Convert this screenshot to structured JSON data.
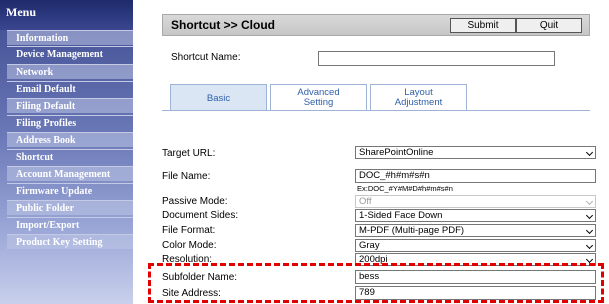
{
  "menu": {
    "title": "Menu",
    "items": [
      {
        "label": "Information"
      },
      {
        "label": "Device Management"
      },
      {
        "label": "Network"
      },
      {
        "label": "Email Default"
      },
      {
        "label": "Filing Default"
      },
      {
        "label": "Filing Profiles"
      },
      {
        "label": "Address Book"
      },
      {
        "label": "Shortcut"
      },
      {
        "label": "Account Management"
      },
      {
        "label": "Firmware Update"
      },
      {
        "label": "Public Folder"
      },
      {
        "label": "Import/Export"
      },
      {
        "label": "Product Key Setting"
      }
    ]
  },
  "header": {
    "title": "Shortcut >> Cloud",
    "submit_label": "Submit",
    "quit_label": "Quit"
  },
  "shortcut_name": {
    "label": "Shortcut Name:",
    "value": ""
  },
  "tabs": [
    {
      "label": "Basic",
      "active": true
    },
    {
      "label": "Advanced\nSetting",
      "active": false
    },
    {
      "label": "Layout\nAdjustment",
      "active": false
    }
  ],
  "form": {
    "target_url": {
      "label": "Target URL:",
      "value": "SharePointOnline"
    },
    "file_name": {
      "label": "File Name:",
      "value": "DOC_#h#m#s#n",
      "hint": "Ex:DOC_#Y#M#D#h#m#s#n"
    },
    "passive_mode": {
      "label": "Passive Mode:",
      "value": "Off"
    },
    "document_sides": {
      "label": "Document Sides:",
      "value": "1-Sided Face Down"
    },
    "file_format": {
      "label": "File Format:",
      "value": "M-PDF (Multi-page PDF)"
    },
    "color_mode": {
      "label": "Color Mode:",
      "value": "Gray"
    },
    "resolution": {
      "label": "Resolution:",
      "value": "200dpi"
    },
    "subfolder_name": {
      "label": "Subfolder Name:",
      "value": "bess"
    },
    "site_address": {
      "label": "Site Address:",
      "value": "789"
    }
  },
  "colors": {
    "menu_dark": "#1f2a6b",
    "tab_text": "#2f5fa8",
    "tab_active_bg": "#dbe6f5",
    "highlight_border": "#e00000"
  }
}
